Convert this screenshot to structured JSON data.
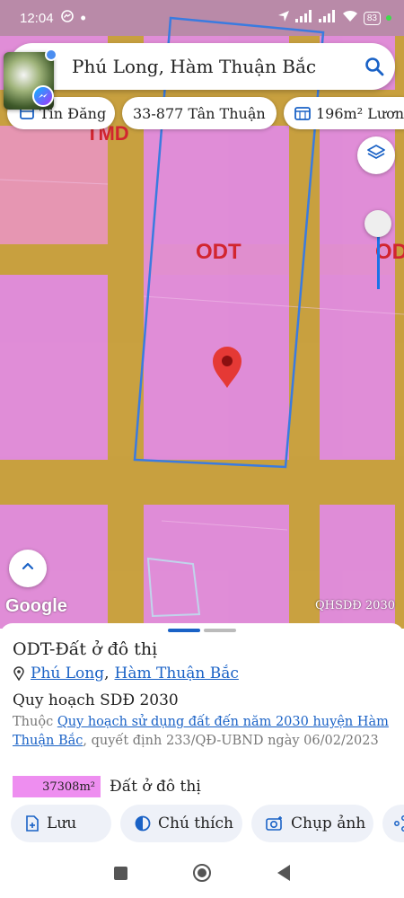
{
  "status_bar": {
    "time": "12:04",
    "battery": "83"
  },
  "search": {
    "query": "Phú Long, Hàm Thuận Bắc"
  },
  "chips": [
    {
      "label": "Tin Đăng"
    },
    {
      "label": "33-877 Tân Thuận"
    },
    {
      "label": "196m² Lươn"
    }
  ],
  "map": {
    "zone_label_main": "ODT",
    "zone_label_right": "OD",
    "zone_label_top": "TMD",
    "google_label": "Google",
    "source_label": "QHSDĐ 2030",
    "colors": {
      "zone_fill": "#d98ad0",
      "road_fill": "#c9a23a",
      "parcel_outline": "#3a7be0",
      "marker": "#e53935"
    }
  },
  "sheet": {
    "title": "ODT-Đất ở đô thị",
    "address_commune": "Phú Long",
    "address_separator": ",",
    "address_district": "Hàm Thuận Bắc",
    "plan_title": "Quy hoạch SDĐ 2030",
    "desc_prefix": "Thuộc",
    "desc_link": "Quy hoạch sử dụng đất đến năm 2030 huyện Hàm Thuận Bắc",
    "desc_suffix": ", quyết định 233/QĐ-UBND ngày 06/02/2023",
    "area_value": "37308m²",
    "area_label": "Đất ở đô thị"
  },
  "actions": [
    {
      "label": "Lưu",
      "icon": "save-icon"
    },
    {
      "label": "Chú thích",
      "icon": "legend-icon"
    },
    {
      "label": "Chụp ảnh",
      "icon": "camera-icon"
    }
  ]
}
